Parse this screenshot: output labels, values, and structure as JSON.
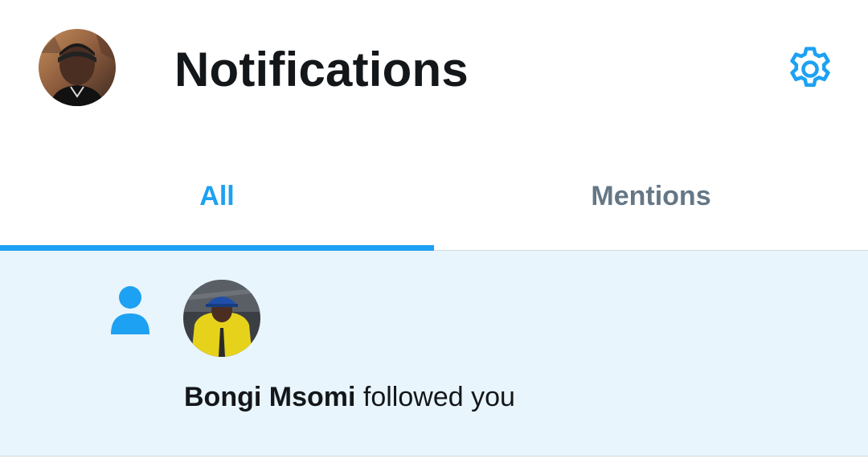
{
  "header": {
    "title": "Notifications",
    "profile_avatar_icon": "user-avatar-photo",
    "settings_icon": "gear-icon"
  },
  "tabs": [
    {
      "label": "All",
      "active": true
    },
    {
      "label": "Mentions",
      "active": false
    }
  ],
  "notifications": [
    {
      "type_icon": "person-icon",
      "avatar_icon": "user-avatar-photo",
      "name": "Bongi Msomi",
      "action": "followed you"
    }
  ],
  "colors": {
    "accent": "#1da1f2",
    "title_text": "#14171a",
    "inactive_tab": "#657786",
    "unread_background": "#e8f5fd"
  }
}
